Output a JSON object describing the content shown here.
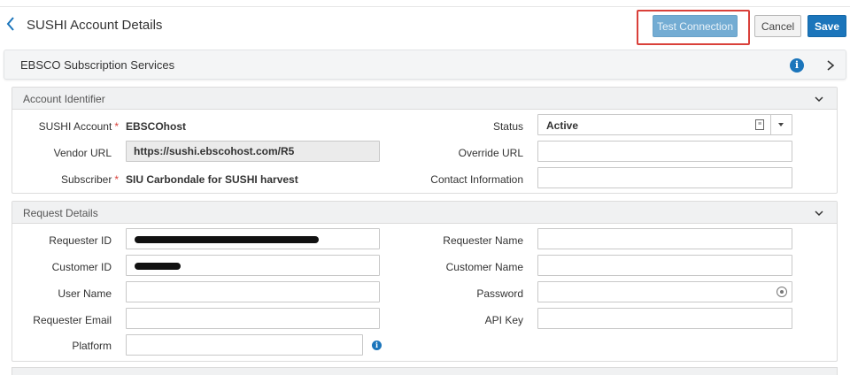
{
  "header": {
    "title": "SUSHI Account Details",
    "test_connection_label": "Test Connection",
    "cancel_label": "Cancel",
    "save_label": "Save"
  },
  "vendor": {
    "name": "EBSCO Subscription Services"
  },
  "account_identifier": {
    "title": "Account Identifier",
    "sushi_account_label": "SUSHI Account",
    "sushi_account_value": "EBSCOhost",
    "vendor_url_label": "Vendor URL",
    "vendor_url_value": "https://sushi.ebscohost.com/R5",
    "subscriber_label": "Subscriber",
    "subscriber_value": "SIU Carbondale for SUSHI harvest",
    "status_label": "Status",
    "status_value": "Active",
    "override_url_label": "Override URL",
    "override_url_value": "",
    "contact_information_label": "Contact Information",
    "contact_information_value": "",
    "required_marker": "*"
  },
  "request_details": {
    "title": "Request Details",
    "requester_id_label": "Requester ID",
    "customer_id_label": "Customer ID",
    "user_name_label": "User Name",
    "user_name_value": "",
    "requester_email_label": "Requester Email",
    "requester_email_value": "",
    "platform_label": "Platform",
    "platform_value": "",
    "requester_name_label": "Requester Name",
    "requester_name_value": "",
    "customer_name_label": "Customer Name",
    "customer_name_value": "",
    "password_label": "Password",
    "password_value": "",
    "api_key_label": "API Key",
    "api_key_value": ""
  },
  "colors": {
    "accent": "#1b75bb",
    "test_connection_bg": "#73acd3",
    "highlight_border": "#d9403a",
    "required": "#d9403a"
  },
  "icons": {
    "back": "chevron-left-icon",
    "info": "info-icon",
    "expand": "chevron-right-icon",
    "collapse": "chevron-down-icon",
    "password_toggle": "eye-icon"
  }
}
